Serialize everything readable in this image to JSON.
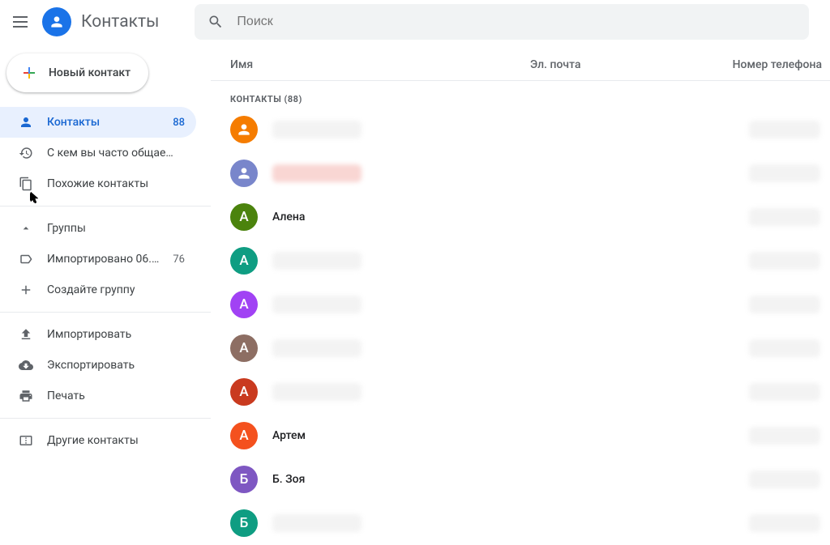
{
  "app": {
    "title": "Контакты"
  },
  "search": {
    "placeholder": "Поиск"
  },
  "sidebar": {
    "new_contact": "Новый контакт",
    "items": [
      {
        "label": "Контакты",
        "count": "88",
        "icon": "person"
      },
      {
        "label": "С кем вы часто общае…",
        "icon": "history"
      },
      {
        "label": "Похожие контакты",
        "icon": "copy"
      }
    ],
    "groups_header": "Группы",
    "groups": [
      {
        "label": "Импортировано 06.…",
        "count": "76",
        "icon": "label"
      },
      {
        "label": "Создайте группу",
        "icon": "plus"
      }
    ],
    "actions": [
      {
        "label": "Импортировать",
        "icon": "upload"
      },
      {
        "label": "Экспортировать",
        "icon": "cloud-download"
      },
      {
        "label": "Печать",
        "icon": "print"
      }
    ],
    "other": {
      "label": "Другие контакты",
      "icon": "archive"
    }
  },
  "main": {
    "columns": {
      "name": "Имя",
      "email": "Эл. почта",
      "phone": "Номер телефона"
    },
    "section_label": "КОНТАКТЫ (88)",
    "contacts": [
      {
        "avatar_letter": "",
        "avatar_color": "#f57c00",
        "avatar_type": "person",
        "name": "",
        "redacted_name": true,
        "redacted_phone": true
      },
      {
        "avatar_letter": "",
        "avatar_color": "#7986cb",
        "avatar_type": "person",
        "name": "",
        "redacted_name": true,
        "redacted_red": true,
        "redacted_phone": true
      },
      {
        "avatar_letter": "А",
        "avatar_color": "#4b830d",
        "name": "Алена",
        "redacted_phone": true
      },
      {
        "avatar_letter": "А",
        "avatar_color": "#0f9d82",
        "name": "",
        "redacted_name": true,
        "redacted_phone": true
      },
      {
        "avatar_letter": "А",
        "avatar_color": "#a142f4",
        "name": "",
        "redacted_name": true,
        "redacted_phone": true
      },
      {
        "avatar_letter": "А",
        "avatar_color": "#8d6e63",
        "name": "",
        "redacted_name": true,
        "redacted_phone": true
      },
      {
        "avatar_letter": "А",
        "avatar_color": "#c93a1f",
        "name": "",
        "redacted_name": true,
        "redacted_phone": true
      },
      {
        "avatar_letter": "А",
        "avatar_color": "#f4511e",
        "name": "Артем",
        "redacted_phone": true
      },
      {
        "avatar_letter": "Б",
        "avatar_color": "#7e57c2",
        "name": "Б. Зоя",
        "redacted_phone": true
      },
      {
        "avatar_letter": "Б",
        "avatar_color": "#0f9d82",
        "name": "",
        "redacted_name": true,
        "redacted_phone": true
      }
    ]
  }
}
